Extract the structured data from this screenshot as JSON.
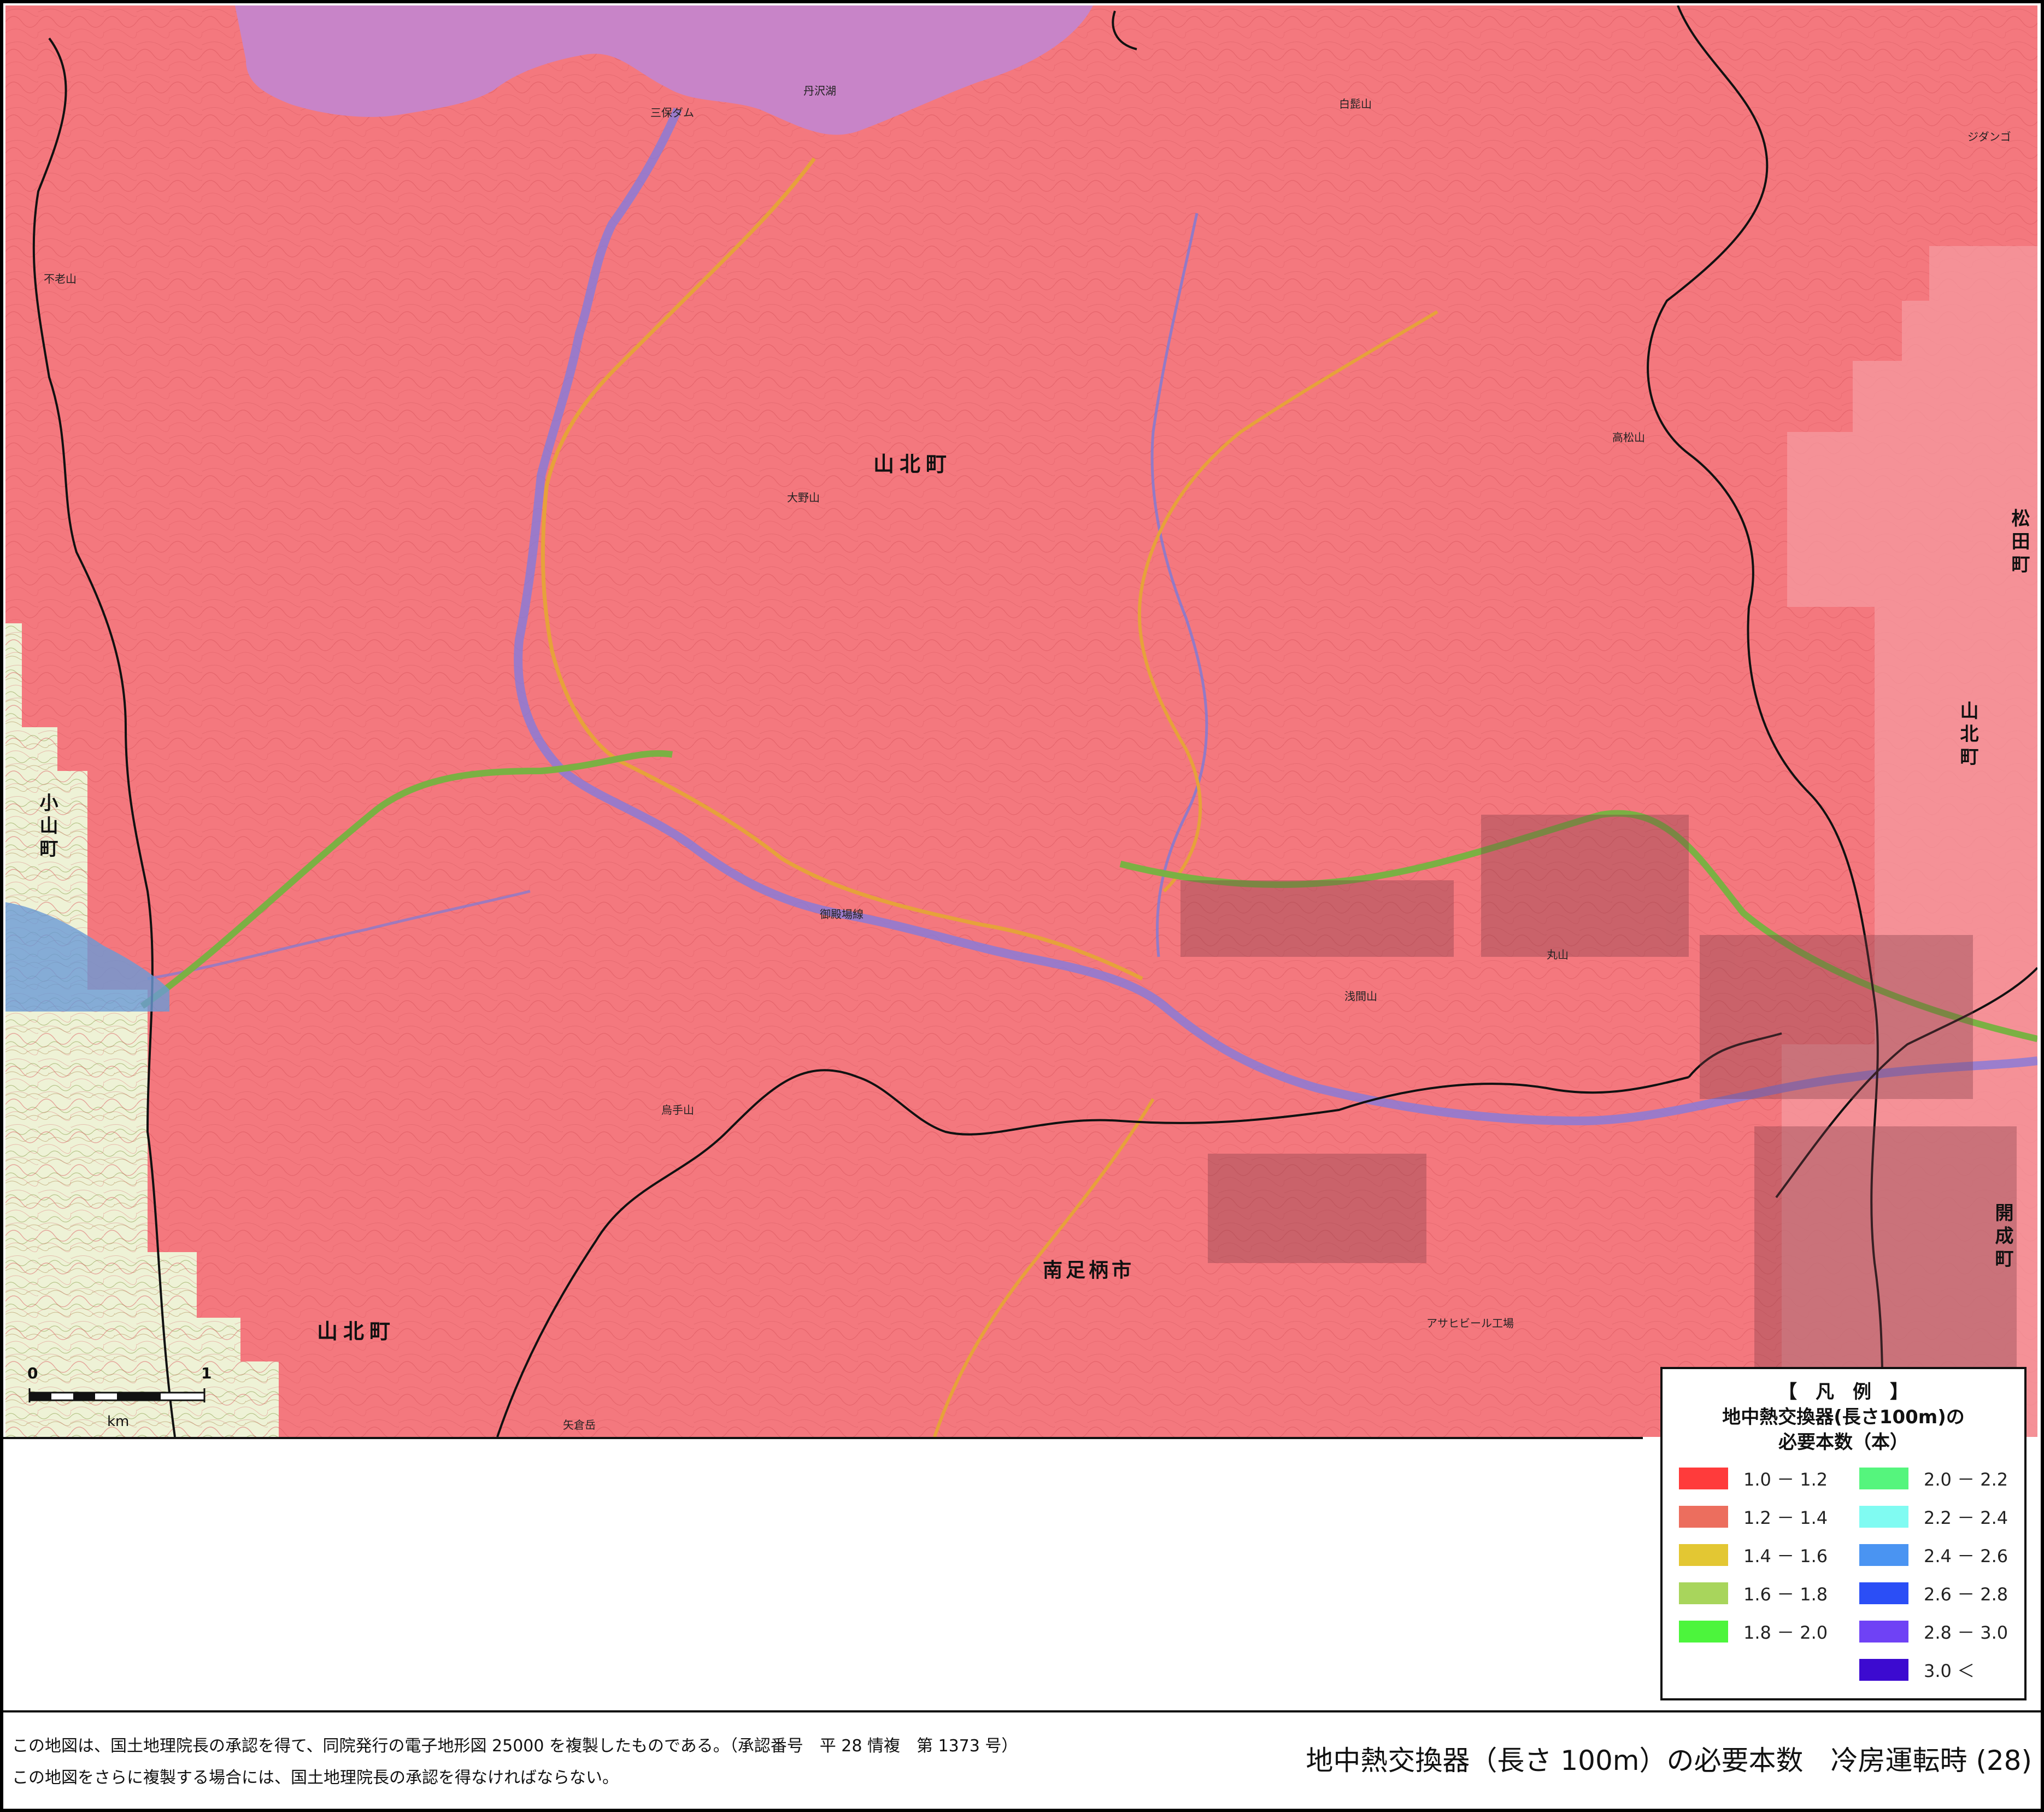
{
  "map": {
    "place_names": {
      "yamakita_center": "山北町",
      "yamakita_southwest": "山北町",
      "yamakita_east": "山北町",
      "oyama": "小山町",
      "matsuda": "松田町",
      "minamiashigara": "南足柄市",
      "kaisei": "開成町"
    },
    "features": {
      "shiraishi_yama": "白髭山",
      "takamatsu_yama": "高松山",
      "oono_yama": "大野山",
      "eboshi_yama": "烏手山",
      "maru_yama": "丸山",
      "sengen_yama": "浅間山",
      "fuhaku_yama": "不老山",
      "miho_dam": "三保ダム",
      "tanzawa_ko": "丹沢湖",
      "jidanko": "ジダンゴ",
      "gotemba_line": "御殿場線",
      "asahi_beer": "アサヒビール工場",
      "yagura_dake": "矢倉岳"
    },
    "colors": {
      "overlay": "#f4787e",
      "lake": "#c884c8",
      "road_major": "#e6a23a",
      "expressway": "#7bb043",
      "river": "#7a7ad8",
      "boundary": "#111111"
    }
  },
  "scale": {
    "zero": "0",
    "one": "1",
    "unit": "km"
  },
  "legend": {
    "bracket_title": "【　凡　例　】",
    "title_line1": "地中熱交換器(長さ100m)の",
    "title_line2": "必要本数（本）",
    "items": [
      {
        "label": "1.0 － 1.2",
        "color": "#ff3b3b"
      },
      {
        "label": "1.2 － 1.4",
        "color": "#ec6e5e"
      },
      {
        "label": "1.4 － 1.6",
        "color": "#e3c733"
      },
      {
        "label": "1.6 － 1.8",
        "color": "#a8d55c"
      },
      {
        "label": "1.8 － 2.0",
        "color": "#4cf53c"
      },
      {
        "label": "2.0 － 2.2",
        "color": "#55f57d"
      },
      {
        "label": "2.2 － 2.4",
        "color": "#80fbf2"
      },
      {
        "label": "2.4 － 2.6",
        "color": "#4a94f2"
      },
      {
        "label": "2.6 － 2.8",
        "color": "#2b4ef6"
      },
      {
        "label": "2.8 － 3.0",
        "color": "#6f42f5"
      },
      {
        "label": "3.0 ＜",
        "color": "#3c0ad0"
      }
    ]
  },
  "footer": {
    "note1": "この地図は、国土地理院長の承認を得て、同院発行の電子地形図 25000 を複製したものである。（承認番号　平 28 情複　第 1373 号）",
    "note2": "この地図をさらに複製する場合には、国土地理院長の承認を得なければならない。",
    "title": "地中熱交換器（長さ 100m）の必要本数　冷房運転時 (28)"
  }
}
